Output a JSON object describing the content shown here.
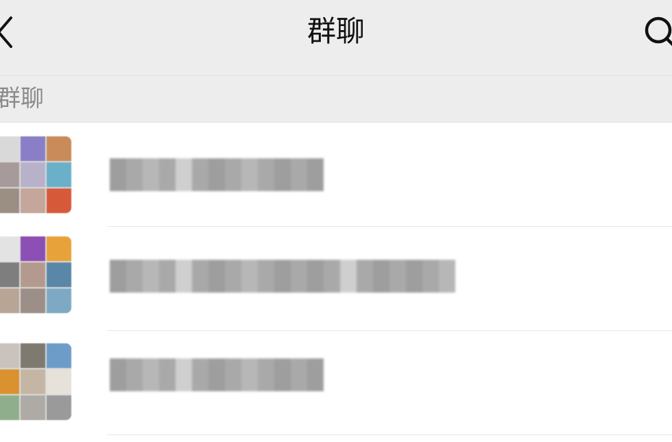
{
  "header": {
    "title": "群聊",
    "back_icon": "chevron-left-icon",
    "search_icon": "search-icon"
  },
  "section": {
    "label": "群聊"
  },
  "groups": [
    {
      "name_state": "pixelated"
    },
    {
      "name_state": "pixelated"
    },
    {
      "name_state": "pixelated"
    }
  ],
  "colors": {
    "header_bg": "#ededed",
    "list_bg": "#ffffff",
    "section_text": "#8a8a8a",
    "title_text": "#111111"
  }
}
